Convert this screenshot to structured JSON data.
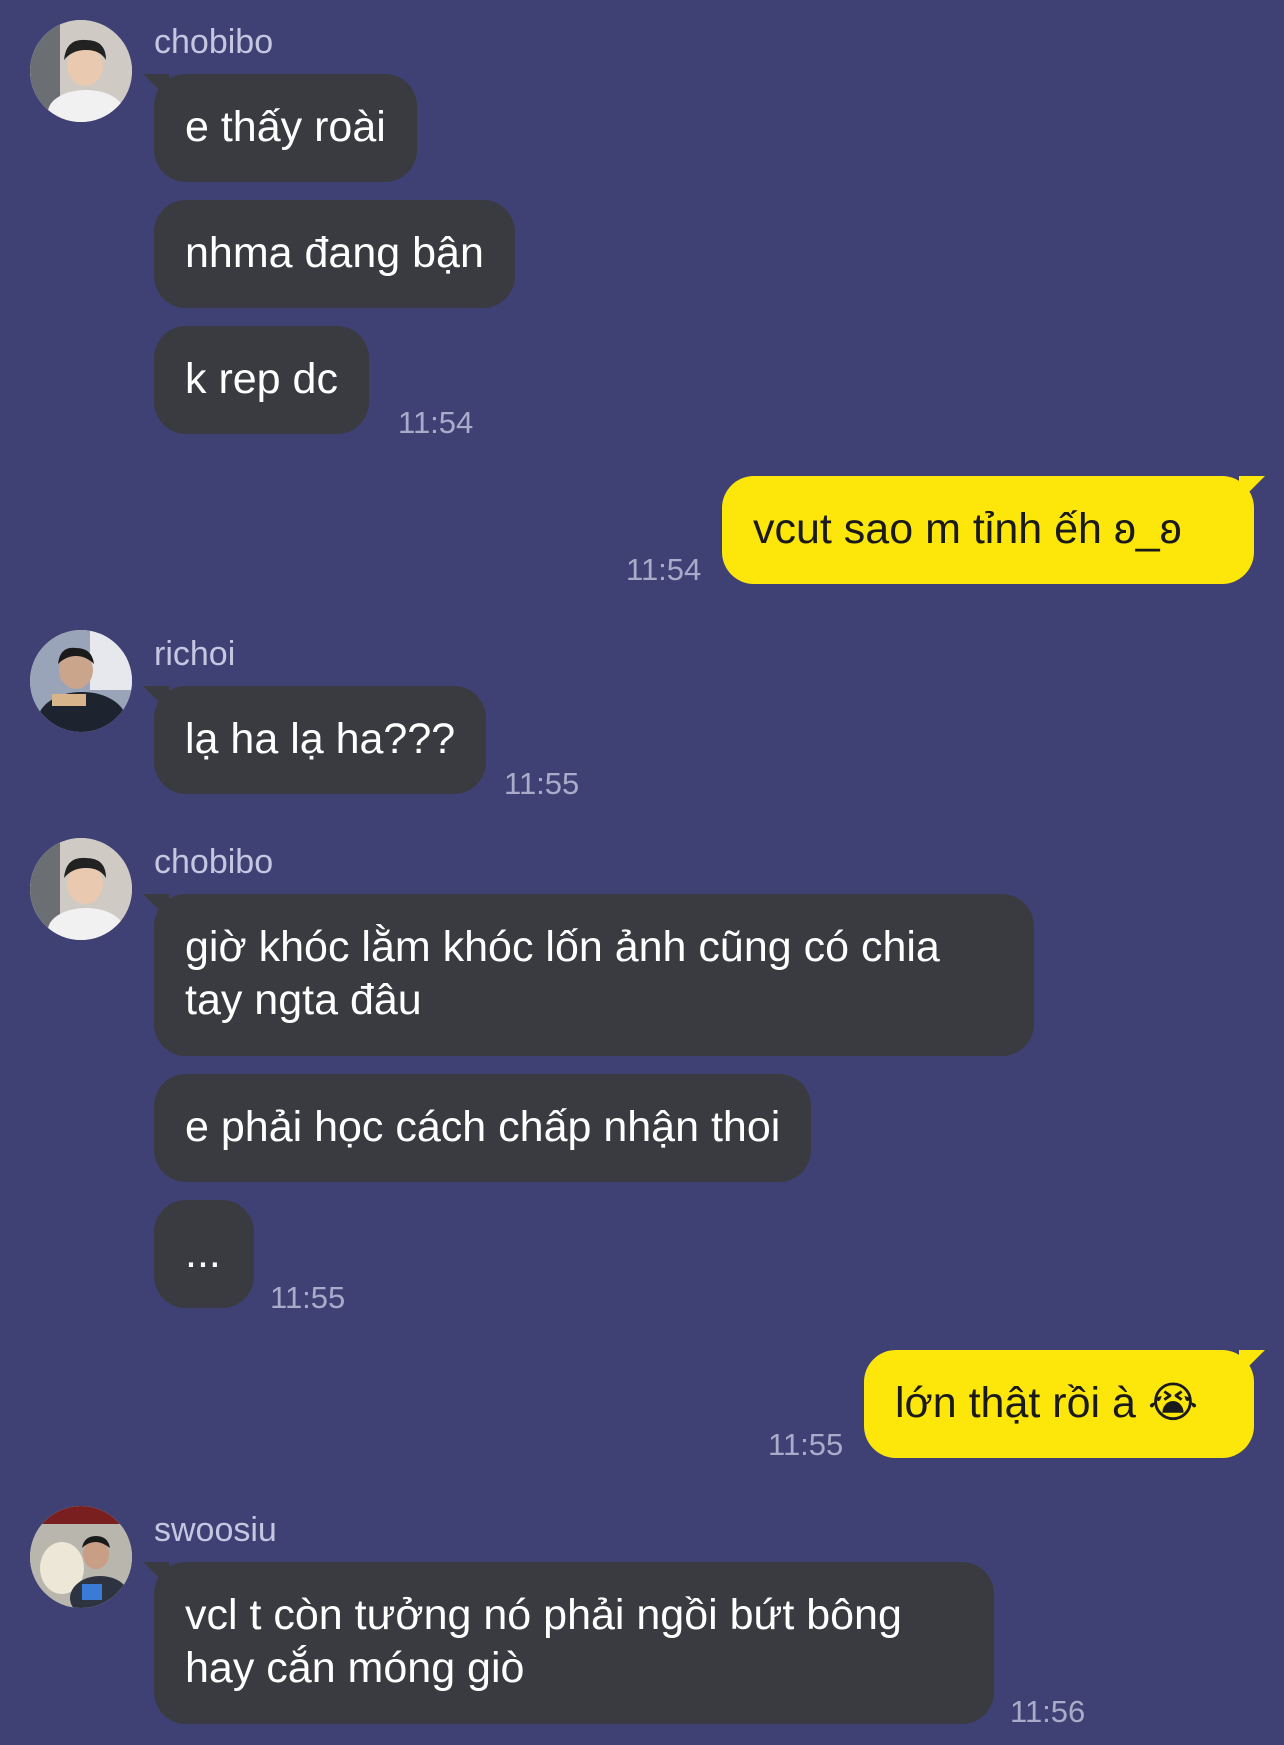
{
  "groups": [
    {
      "sender": "chobibo",
      "avatar": "chobibo-avatar",
      "messages": [
        "e thấy roài",
        "nhma đang bận",
        "k rep dc"
      ],
      "time": "11:54"
    },
    {
      "sender": "me",
      "messages": [
        "vcut sao m tỉnh ếh ʚ̈_ʚ̈"
      ],
      "display": "vcut sao m tỉnh ếh ♂_♂",
      "time": "11:54"
    },
    {
      "sender": "richoi",
      "avatar": "richoi-avatar",
      "messages": [
        "lạ ha lạ ha???"
      ],
      "time": "11:55"
    },
    {
      "sender": "chobibo",
      "avatar": "chobibo-avatar",
      "messages": [
        "giờ khóc lằm khóc lốn ảnh cũng có chia tay ngta đâu",
        "e phải học cách chấp nhận thoi",
        "..."
      ],
      "time": "11:55"
    },
    {
      "sender": "me",
      "messages": [
        "lớn thật rồi à 😭"
      ],
      "time": "11:55"
    },
    {
      "sender": "swoosiu",
      "avatar": "swoosiu-avatar",
      "messages": [
        "vcl t còn tưởng nó phải ngồi bứt bông hay cắn móng giò"
      ],
      "time": "11:56"
    }
  ],
  "labels": {
    "g1_name": "chobibo",
    "g1_m1": "e thấy roài",
    "g1_m2": "nhma đang bận",
    "g1_m3": "k rep dc",
    "g1_time": "11:54",
    "g2_m1": "vcut sao m tỉnh ếh ʚ_ʚ",
    "g2_time": "11:54",
    "g3_name": "richoi",
    "g3_m1": "lạ ha lạ ha???",
    "g3_time": "11:55",
    "g4_name": "chobibo",
    "g4_m1": "giờ khóc lằm khóc lốn ảnh cũng có chia tay ngta đâu",
    "g4_m2": "e phải học cách chấp nhận thoi",
    "g4_m3": "...",
    "g4_time": "11:55",
    "g5_m1": "lớn thật rồi à 😭",
    "g5_time": "11:55",
    "g6_name": "swoosiu",
    "g6_m1": "vcl t còn tưởng nó phải ngồi bứt bông hay cắn móng giò",
    "g6_time": "11:56"
  },
  "colors": {
    "background": "#3f4175",
    "incoming_bubble": "#3a3b40",
    "outgoing_bubble": "#fde609",
    "timestamp": "#a9abc9"
  }
}
